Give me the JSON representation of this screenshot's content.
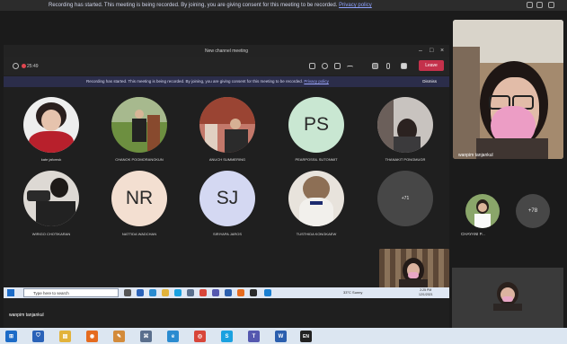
{
  "banner": {
    "text": "Recording has started. This meeting is being recorded. By joining, you are giving consent for this meeting to be recorded.",
    "link": "Privacy policy"
  },
  "window": {
    "title": "New channel meeting",
    "timer": "25:49",
    "leave_label": "Leave"
  },
  "recording_bar": {
    "text": "Recording has started. This meeting is being recorded. By joining, you are giving consent for this meeting to be recorded.",
    "link": "Privacy policy",
    "dismiss": "Dismiss"
  },
  "participants": [
    {
      "name": "kate jafomsk",
      "type": "photo",
      "color": "#b8202c"
    },
    {
      "name": "CHANOK POOMORANGKUN",
      "type": "photo",
      "color": "#5e8a3a"
    },
    {
      "name": "ANUCH SUMMERING",
      "type": "photo",
      "color": "#9a4433"
    },
    {
      "name": "PEARPOSSIL SUTONMIT",
      "initials": "PS",
      "type": "initials",
      "color": "#c9e7d2"
    },
    {
      "name": "THANAKIT PONGMUGR",
      "type": "photo",
      "color": "#5d4d46"
    },
    {
      "name": "WIRIGO CHOTIKARAN",
      "type": "photo",
      "color": "#ddd9d4"
    },
    {
      "name": "NATTIDA WADCHAN",
      "initials": "NR",
      "type": "initials",
      "color": "#f3dfd1"
    },
    {
      "name": "SIRIYAPA JAROS",
      "initials": "SJ",
      "type": "initials",
      "color": "#d4d8f2"
    },
    {
      "name": "TUSTHIDA KONGKAEW",
      "type": "photo",
      "color": "#8d6f55"
    },
    {
      "name": "",
      "type": "more",
      "label": "+71",
      "color": "#474747"
    }
  ],
  "side_panel": {
    "speaker_name": "wanpim tanjankul",
    "attendee_name": "CHAYANI P...",
    "more_label": "+78"
  },
  "inner_taskbar": {
    "search_placeholder": "Type here to search",
    "weather": "33°C Sunny",
    "time": "2:25 PM",
    "date": "12/1/2021"
  },
  "self_name": "wanpim tanjankul",
  "outer_taskbar_apps": [
    {
      "name": "start",
      "color": "#1c6bc7",
      "glyph": "⊞"
    },
    {
      "name": "shield",
      "color": "#2a62b8",
      "glyph": "⛉"
    },
    {
      "name": "file-explorer",
      "color": "#e2b33b",
      "glyph": "▤"
    },
    {
      "name": "firefox",
      "color": "#e56b1f",
      "glyph": "◉"
    },
    {
      "name": "paint",
      "color": "#d38b3b",
      "glyph": "✎"
    },
    {
      "name": "network",
      "color": "#5a6f8d",
      "glyph": "⌘"
    },
    {
      "name": "edge",
      "color": "#2a8bd0",
      "glyph": "e"
    },
    {
      "name": "chrome",
      "color": "#d8463a",
      "glyph": "◎"
    },
    {
      "name": "skype",
      "color": "#1aa1e0",
      "glyph": "S"
    },
    {
      "name": "teams",
      "color": "#5558af",
      "glyph": "T"
    },
    {
      "name": "word",
      "color": "#2b5fae",
      "glyph": "W"
    },
    {
      "name": "language",
      "color": "#222222",
      "glyph": "EN"
    }
  ]
}
